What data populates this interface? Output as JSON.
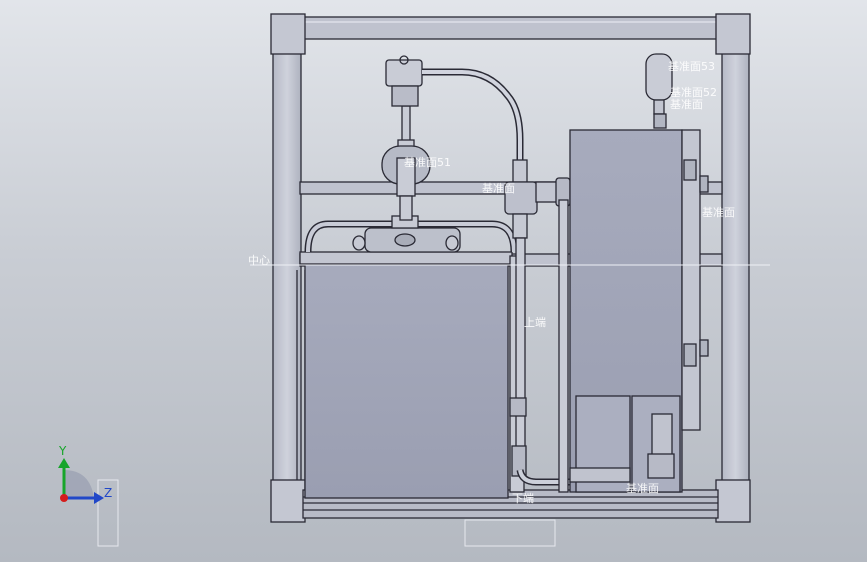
{
  "model_view": {
    "labels": {
      "plane_ref_1": "基准面53",
      "plane_ref_2": "基准面52",
      "plane_ref_3": "基准面51",
      "plane_ref_4": "基准面",
      "plane_ref_5": "基准面",
      "plane_ref_6": "基准面",
      "axis_ref": "中心",
      "pipe_ref_1": "上端",
      "pipe_ref_2": "下端",
      "floor_ref": "基准面"
    },
    "triad": {
      "y_label": "Y",
      "z_label": "Z"
    }
  }
}
